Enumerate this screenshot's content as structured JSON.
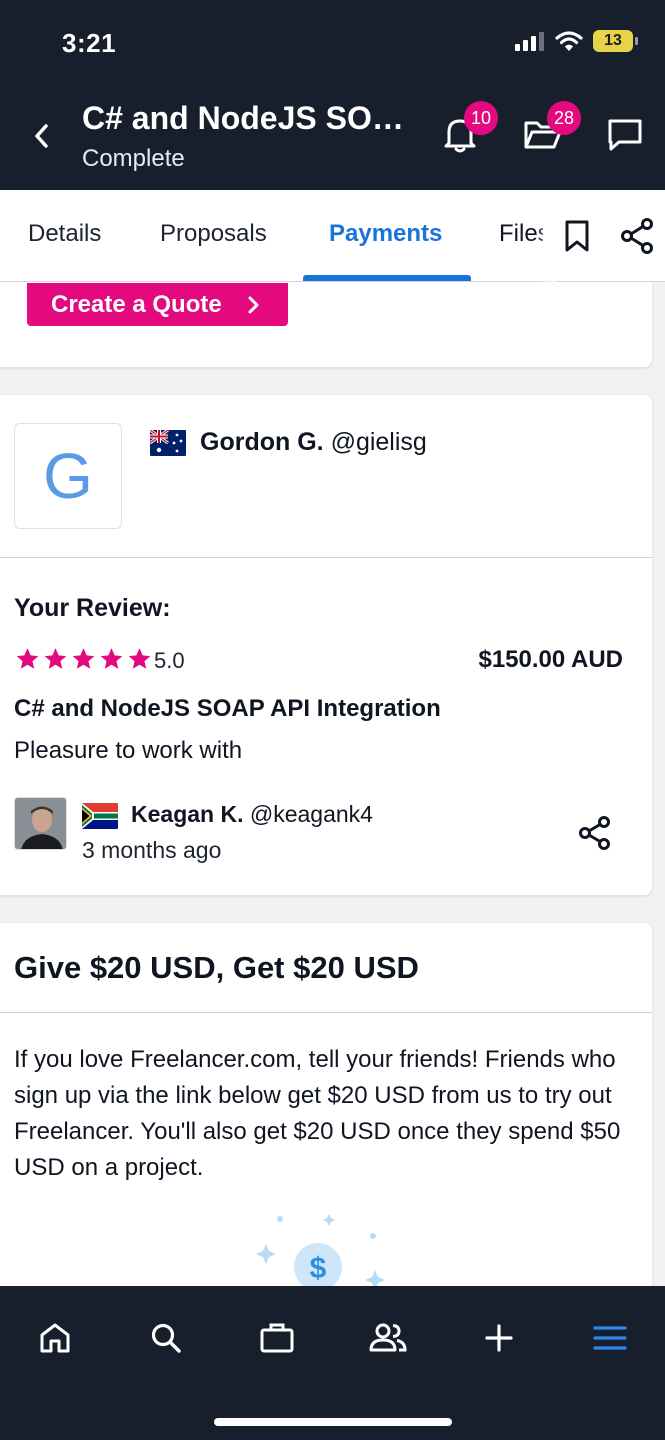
{
  "status_bar": {
    "time": "3:21",
    "battery": "13"
  },
  "header": {
    "title": "C# and NodeJS SO…",
    "subtitle": "Complete",
    "notifications_count": "10",
    "projects_count": "28"
  },
  "tabs": [
    {
      "label": "Details"
    },
    {
      "label": "Proposals"
    },
    {
      "label": "Payments",
      "active": true
    },
    {
      "label": "Files"
    }
  ],
  "quote": {
    "button_label": "Create a Quote"
  },
  "client": {
    "initial": "G",
    "name": "Gordon G.",
    "handle": "@gielisg",
    "flag": "australia-flag-icon"
  },
  "review": {
    "label": "Your Review:",
    "stars": 5,
    "rating": "5.0",
    "price": "$150.00 AUD",
    "project_title": "C# and NodeJS SOAP API Integration",
    "text": "Pleasure to work with",
    "reviewer": {
      "name": "Keagan K.",
      "handle": "@keagank4",
      "time_ago": "3 months ago",
      "flag": "south-africa-flag-icon"
    }
  },
  "promo": {
    "title": "Give $20 USD, Get $20 USD",
    "body": "If you love Freelancer.com, tell your friends! Friends who sign up via the link below get $20 USD from us to try out Freelancer. You'll also get $20 USD once they spend $50 USD on a project."
  },
  "colors": {
    "header_bg": "#181f2c",
    "accent_pink": "#e4097f",
    "accent_blue": "#1a73d9"
  },
  "bottom_nav": [
    "home-icon",
    "search-icon",
    "briefcase-icon",
    "people-icon",
    "plus-icon",
    "menu-icon"
  ]
}
